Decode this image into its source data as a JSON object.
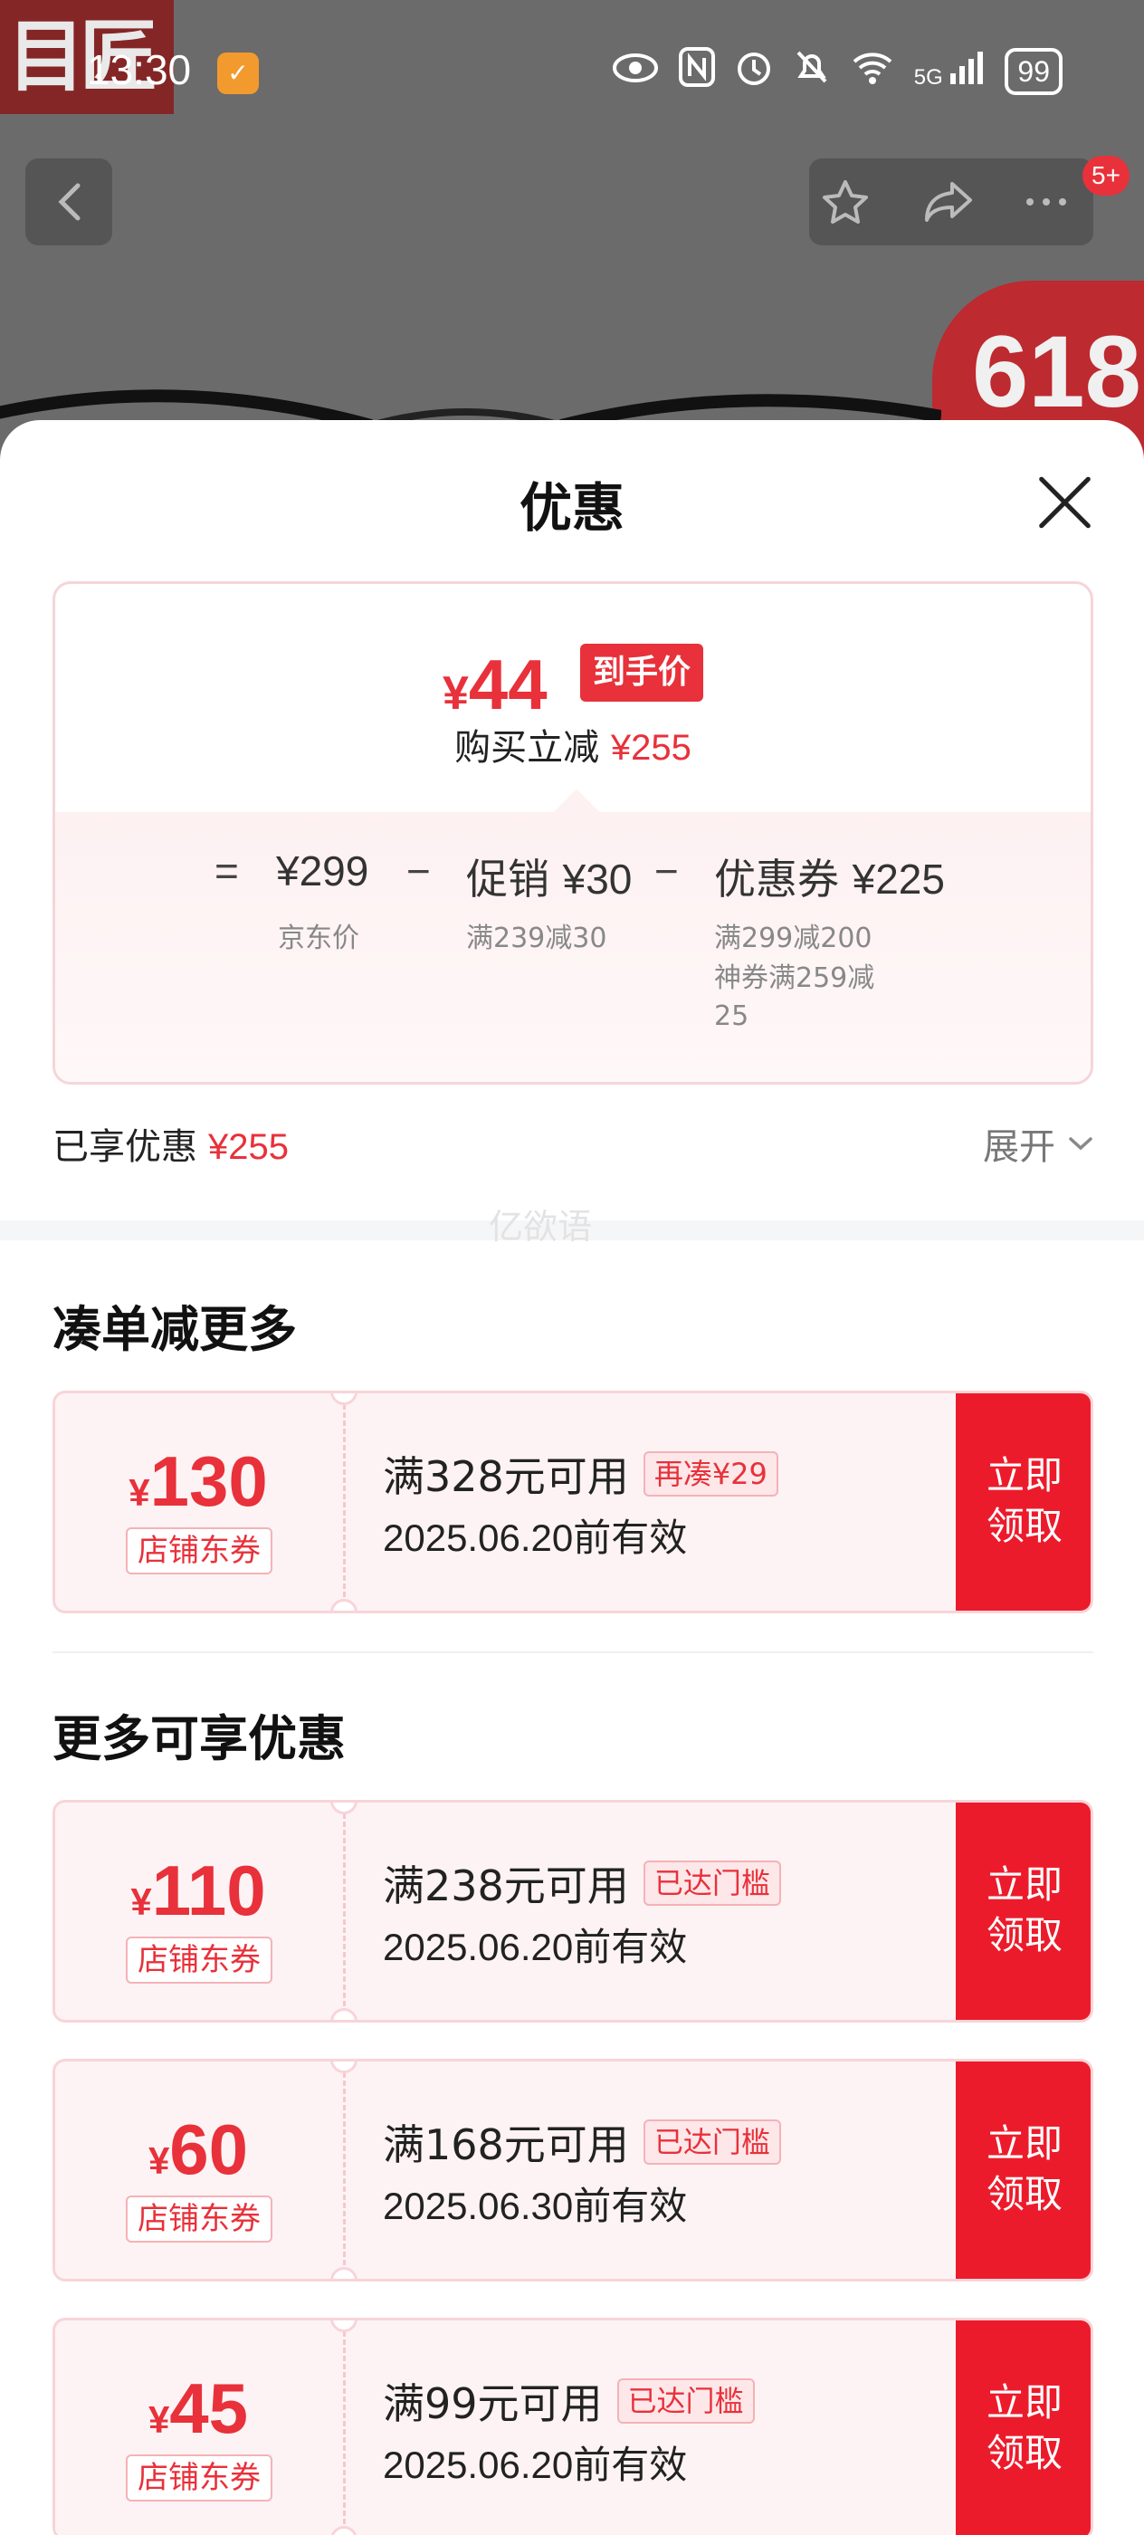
{
  "status_bar": {
    "time": "13:30",
    "network": "5G",
    "battery": "99"
  },
  "background": {
    "logo_text": "目匠",
    "badge_count": "5+",
    "promo_label": "618"
  },
  "sheet": {
    "title": "优惠",
    "final_price": {
      "currency": "¥",
      "value": "44",
      "tag": "到手价"
    },
    "save": {
      "label": "购买立减",
      "amount": "¥255"
    },
    "breakdown": {
      "equals": "=",
      "minus": "−",
      "jd_price": {
        "label": "¥299",
        "sub": "京东价"
      },
      "promo": {
        "label": "促销",
        "price": "¥30",
        "sub": "满239减30"
      },
      "coupon": {
        "label": "优惠券",
        "price": "¥225",
        "sub1": "满299减200",
        "sub2": "神券满259减",
        "sub3": "25"
      }
    },
    "enjoyed": {
      "label": "已享优惠",
      "amount": "¥255"
    },
    "expand_label": "展开",
    "watermark": "亿欲语"
  },
  "section_more_order": {
    "title": "凑单减更多",
    "coupons": [
      {
        "currency": "¥",
        "amount": "130",
        "kind": "店铺东券",
        "condition": "满328元可用",
        "tag": "再凑¥29",
        "valid": "2025.06.20前有效",
        "claim": [
          "立即",
          "领取"
        ]
      }
    ]
  },
  "section_more_discounts": {
    "title": "更多可享优惠",
    "coupons": [
      {
        "currency": "¥",
        "amount": "110",
        "kind": "店铺东券",
        "condition": "满238元可用",
        "tag": "已达门槛",
        "valid": "2025.06.20前有效",
        "claim": [
          "立即",
          "领取"
        ]
      },
      {
        "currency": "¥",
        "amount": "60",
        "kind": "店铺东券",
        "condition": "满168元可用",
        "tag": "已达门槛",
        "valid": "2025.06.30前有效",
        "claim": [
          "立即",
          "领取"
        ]
      },
      {
        "currency": "¥",
        "amount": "45",
        "kind": "店铺东券",
        "condition": "满99元可用",
        "tag": "已达门槛",
        "valid": "2025.06.20前有效",
        "claim": [
          "立即",
          "领取"
        ]
      }
    ]
  },
  "colors": {
    "accent": "#e8313a",
    "claim_button": "#ec1b2b",
    "coupon_bg": "#fdf3f4"
  }
}
